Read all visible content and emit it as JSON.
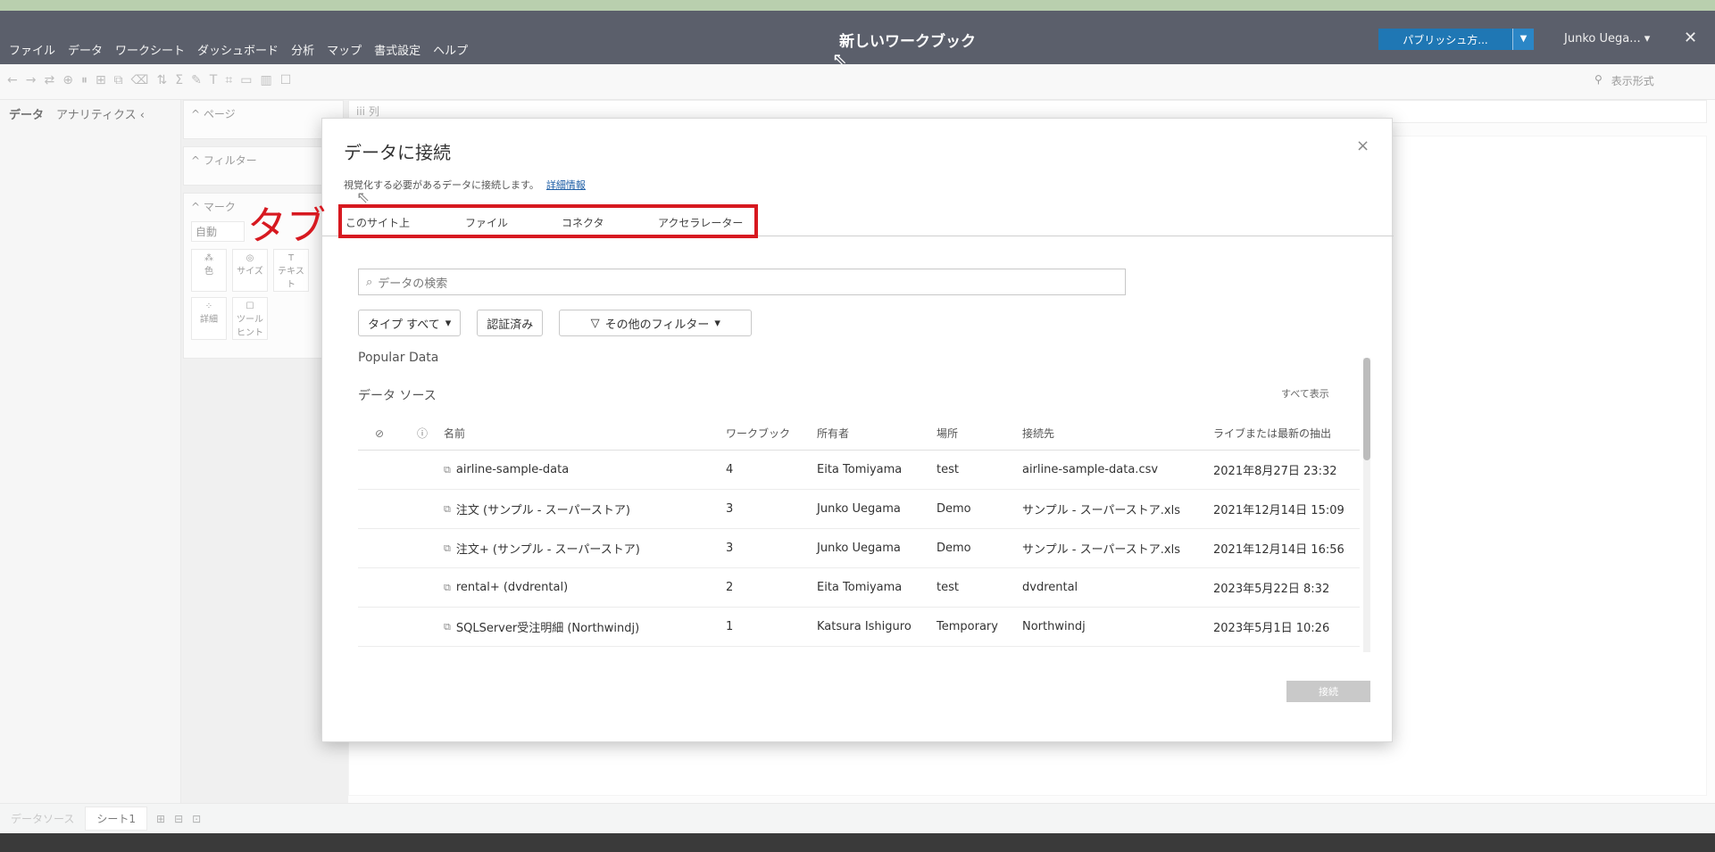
{
  "titlebar": {
    "menu": [
      "ファイル",
      "データ",
      "ワークシート",
      "ダッシュボード",
      "分析",
      "マップ",
      "書式設定",
      "ヘルプ"
    ],
    "workbook_title": "新しいワークブック",
    "publish_label": "パブリッシュ方...",
    "user_label": "Junko Uega... ▾",
    "close_glyph": "✕"
  },
  "toolbar": {
    "format_label": "表示形式"
  },
  "left_pane": {
    "tabs": [
      "データ",
      "アナリティクス  ‹"
    ]
  },
  "cards": {
    "pages": "^ ページ",
    "filters": "^ フィルター",
    "marks": "^ マーク",
    "marks_type": "自動",
    "mark_cells": [
      "色",
      "サイズ",
      "テキスト",
      "詳細",
      "ツールヒント"
    ]
  },
  "canvas": {
    "columns_label": "iii 列"
  },
  "bottom": {
    "data_source": "データソース",
    "sheet": "シート1"
  },
  "dialog": {
    "title": "データに接続",
    "subtitle": "視覚化する必要があるデータに接続します。",
    "subtitle_link": "詳細情報",
    "tabs": [
      "このサイト上",
      "ファイル",
      "コネクタ",
      "アクセラレーター"
    ],
    "annotation": "タブ",
    "search_placeholder": "データの検索",
    "filter_type": "タイプ すべて",
    "filter_certified": "認証済み",
    "filter_more": "その他のフィルター",
    "popular": "Popular Data",
    "section": "データ ソース",
    "show_all": "すべて表示",
    "columns": [
      "名前",
      "ワークブック",
      "所有者",
      "場所",
      "接続先",
      "ライブまたは最新の抽出"
    ],
    "rows": [
      {
        "name": "airline-sample-data",
        "workbooks": "4",
        "owner": "Eita Tomiyama",
        "location": "test",
        "connection": "airline-sample-data.csv",
        "date": "2021年8月27日 23:32"
      },
      {
        "name": "注文 (サンプル - スーパーストア)",
        "workbooks": "3",
        "owner": "Junko Uegama",
        "location": "Demo",
        "connection": "サンプル - スーパーストア.xls",
        "date": "2021年12月14日 15:09"
      },
      {
        "name": "注文+ (サンプル - スーパーストア)",
        "workbooks": "3",
        "owner": "Junko Uegama",
        "location": "Demo",
        "connection": "サンプル - スーパーストア.xls",
        "date": "2021年12月14日 16:56"
      },
      {
        "name": "rental+ (dvdrental)",
        "workbooks": "2",
        "owner": "Eita Tomiyama",
        "location": "test",
        "connection": "dvdrental",
        "date": "2023年5月22日 8:32"
      },
      {
        "name": "SQLServer受注明細 (Northwindj)",
        "workbooks": "1",
        "owner": "Katsura Ishiguro",
        "location": "Temporary",
        "connection": "Northwindj",
        "date": "2023年5月1日 10:26"
      }
    ],
    "connect_label": "接続",
    "close_glyph": "×"
  },
  "colors": {
    "titlebar": "#5b5f6b",
    "publish": "#1f77b4",
    "annotation_red": "#d71920"
  }
}
